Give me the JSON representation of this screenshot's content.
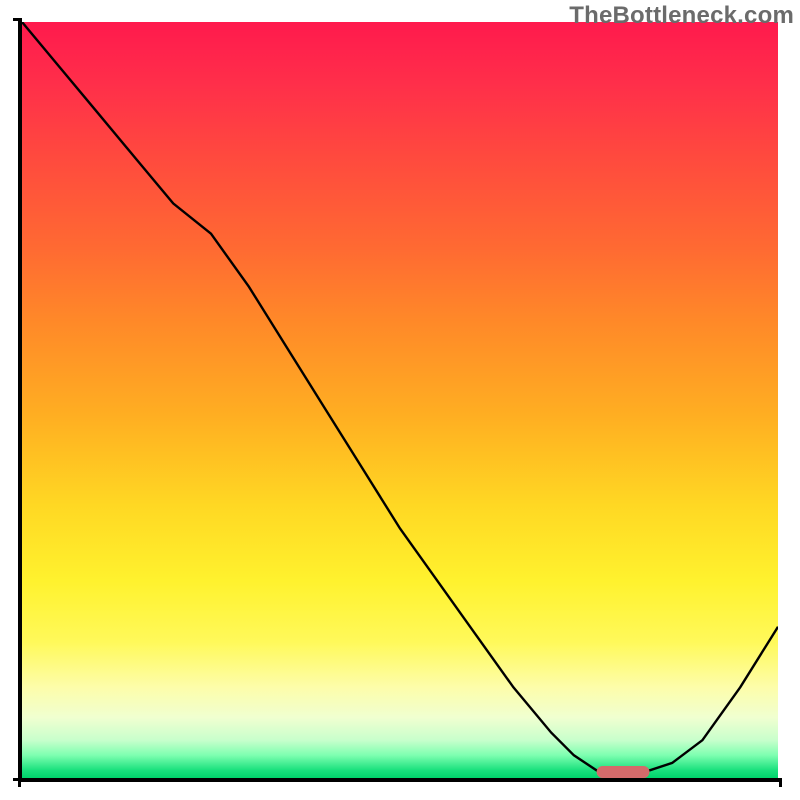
{
  "watermark": "TheBottleneck.com",
  "chart_data": {
    "type": "line",
    "title": "",
    "xlabel": "",
    "ylabel": "",
    "xlim": [
      0,
      100
    ],
    "ylim": [
      0,
      100
    ],
    "grid": false,
    "legend": false,
    "series": [
      {
        "name": "bottleneck-curve",
        "x": [
          0,
          5,
          10,
          15,
          20,
          25,
          30,
          35,
          40,
          45,
          50,
          55,
          60,
          65,
          70,
          73,
          76,
          80,
          83,
          86,
          90,
          95,
          100
        ],
        "y": [
          100,
          94,
          88,
          82,
          76,
          72,
          65,
          57,
          49,
          41,
          33,
          26,
          19,
          12,
          6,
          3,
          1,
          1,
          1,
          2,
          5,
          12,
          20
        ]
      }
    ],
    "marker": {
      "name": "optimal-range",
      "x_start": 76,
      "x_end": 83,
      "y": 0.8
    },
    "background_gradient": {
      "top_color": "#ff1a4d",
      "bottom_color": "#00d36b",
      "description": "red-to-green vertical gradient"
    }
  }
}
